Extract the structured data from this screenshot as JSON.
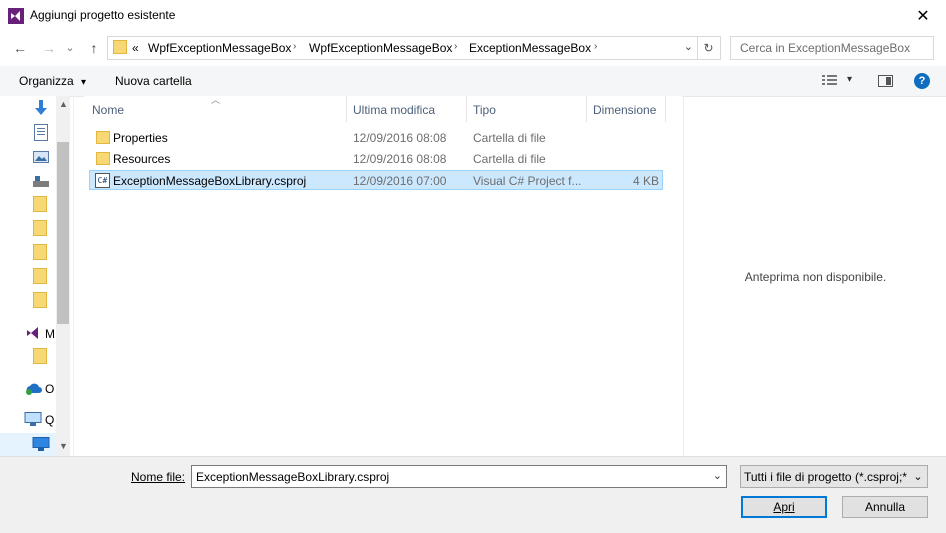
{
  "window": {
    "title": "Aggiungi progetto esistente",
    "close_glyph": "✕"
  },
  "nav": {
    "back_glyph": "←",
    "forward_glyph": "→",
    "recent_glyph": "⌄",
    "up_glyph": "↑",
    "breadcrumb_overflow": "«",
    "breadcrumbs": [
      "WpfExceptionMessageBox",
      "WpfExceptionMessageBox",
      "ExceptionMessageBox"
    ],
    "sep_glyph": "›",
    "addr_dropdown_glyph": "⌄",
    "refresh_glyph": "↻",
    "search_placeholder": "Cerca in ExceptionMessageBox"
  },
  "toolbar": {
    "organize_label": "Organizza",
    "organize_arrow": "▾",
    "new_folder_label": "Nuova cartella",
    "view_arrow": "▾",
    "help_glyph": "?"
  },
  "sidebar": {
    "partial_labels": [
      "M",
      "O",
      "Q"
    ]
  },
  "columns": {
    "name": "Nome",
    "modified": "Ultima modifica",
    "type": "Tipo",
    "size": "Dimensione"
  },
  "files": [
    {
      "name": "Properties",
      "modified": "12/09/2016 08:08",
      "type": "Cartella di file",
      "size": "",
      "kind": "folder"
    },
    {
      "name": "Resources",
      "modified": "12/09/2016 08:08",
      "type": "Cartella di file",
      "size": "",
      "kind": "folder"
    },
    {
      "name": "ExceptionMessageBoxLibrary.csproj",
      "modified": "12/09/2016 07:00",
      "type": "Visual C# Project f...",
      "size": "4 KB",
      "kind": "csproj",
      "icon_text": "C#"
    }
  ],
  "preview": {
    "text": "Anteprima non disponibile."
  },
  "footer": {
    "filename_label": "Nome file:",
    "filename_value": "ExceptionMessageBoxLibrary.csproj",
    "filter_value": "Tutti i file di progetto (*.csproj;*",
    "dropdown_glyph": "⌄",
    "open_label": "Apri",
    "cancel_label": "Annulla"
  },
  "colors": {
    "accent": "#0078d7",
    "selection": "#cce8ff",
    "vs_purple": "#68217a"
  }
}
